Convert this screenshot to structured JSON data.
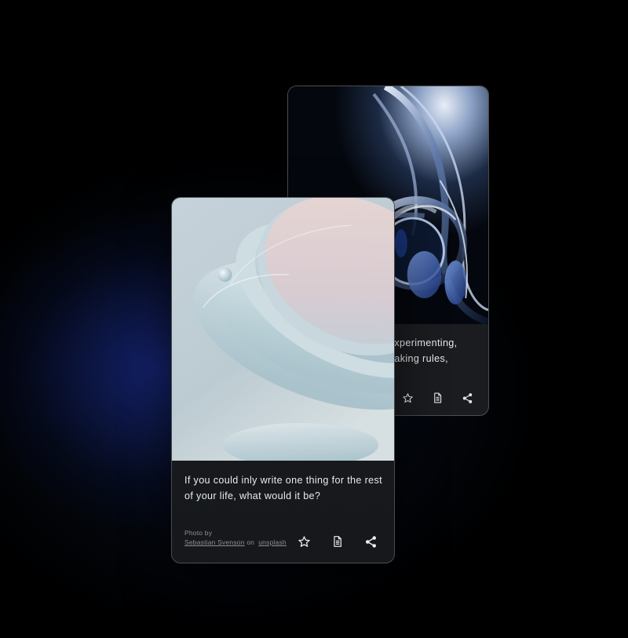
{
  "back_card": {
    "text_line1": "experimenting,",
    "text_line2": "eaking rules,",
    "icons": [
      "star-icon",
      "document-icon",
      "share-icon"
    ]
  },
  "front_card": {
    "question_line1": "If you could inly write one thing for the rest",
    "question_line2": "of your life, what would it be?",
    "photo_by_label": "Photo by",
    "photographer": "Sebastian Svenson",
    "on_label": "on",
    "source": "unsplash",
    "icons": [
      "star-icon",
      "document-icon",
      "share-icon"
    ]
  },
  "colors": {
    "background": "#000000",
    "card_body": "#17191c",
    "text": "#e9ebee",
    "muted_text": "#8b9096",
    "accent_glow": "#1e32aa"
  }
}
